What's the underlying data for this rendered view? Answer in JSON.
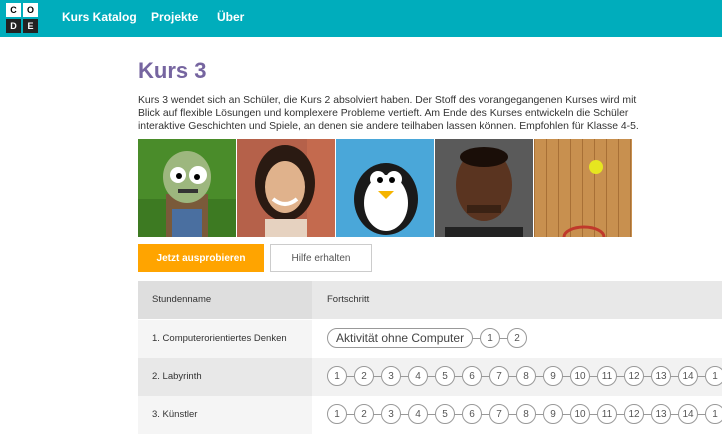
{
  "logo": {
    "letters": [
      "C",
      "O",
      "D",
      "E"
    ]
  },
  "nav": {
    "items": [
      "Kurs Katalog",
      "Projekte",
      "Über"
    ]
  },
  "course": {
    "title": "Kurs 3",
    "description_lines": [
      "Kurs 3 wendet sich an Schüler, die Kurs 2 absolviert haben. Der Stoff des vorangegangenen Kurses wird mit",
      "Blick auf flexible Lösungen und komplexere Probleme vertieft. Am Ende des Kurses entwickeln die Schüler",
      "interaktive Geschichten und Spiele, an denen sie andere teilhaben lassen können. Empfohlen für Klasse 4-5."
    ]
  },
  "images": [
    "zombie-image",
    "person-woman-image",
    "penguin-image",
    "person-man-image",
    "basketball-court-image"
  ],
  "buttons": {
    "try": "Jetzt ausprobieren",
    "help": "Hilfe erhalten"
  },
  "table": {
    "headers": [
      "Stundenname",
      "Fortschritt"
    ],
    "rows": [
      {
        "name": "1. Computerorientiertes Denken",
        "bubbles": [
          "Aktivität ohne Computer",
          "1",
          "2"
        ]
      },
      {
        "name": "2. Labyrinth",
        "bubbles": [
          "1",
          "2",
          "3",
          "4",
          "5",
          "6",
          "7",
          "8",
          "9",
          "10",
          "11",
          "12",
          "13",
          "14",
          "1"
        ]
      },
      {
        "name": "3. Künstler",
        "bubbles": [
          "1",
          "2",
          "3",
          "4",
          "5",
          "6",
          "7",
          "8",
          "9",
          "10",
          "11",
          "12",
          "13",
          "14",
          "1"
        ]
      }
    ]
  },
  "colors": {
    "topbar": "#00adbc",
    "title": "#7665a0",
    "primary_button": "#ffa400"
  }
}
